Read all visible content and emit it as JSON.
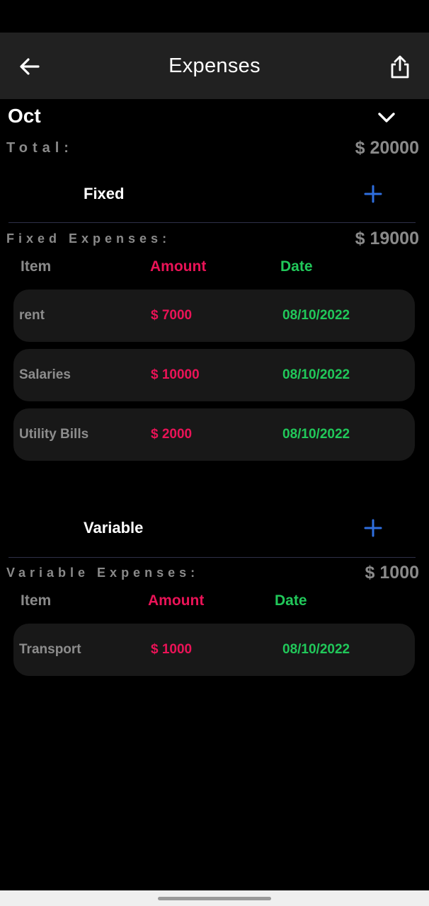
{
  "app_bar": {
    "title": "Expenses",
    "back_icon": "arrow-left-icon",
    "share_icon": "share-icon"
  },
  "month": {
    "label": "Oct",
    "toggle_icon": "chevron-down-icon"
  },
  "total": {
    "label": "Total:",
    "value": "$ 20000"
  },
  "columns": {
    "item": "Item",
    "amount": "Amount",
    "date": "Date"
  },
  "fixed": {
    "title": "Fixed",
    "add_icon": "plus-icon",
    "summary_label": "Fixed Expenses:",
    "summary_value": "$ 19000",
    "rows": [
      {
        "item": "rent",
        "amount": "$ 7000",
        "date": "08/10/2022"
      },
      {
        "item": "Salaries",
        "amount": "$ 10000",
        "date": "08/10/2022"
      },
      {
        "item": "Utility Bills",
        "amount": "$ 2000",
        "date": "08/10/2022"
      }
    ]
  },
  "variable": {
    "title": "Variable",
    "add_icon": "plus-icon",
    "summary_label": "Variable Expenses:",
    "summary_value": "$ 1000",
    "rows": [
      {
        "item": "Transport",
        "amount": "$ 1000",
        "date": "08/10/2022"
      }
    ]
  },
  "colors": {
    "background": "#000000",
    "app_bar": "#212121",
    "muted_text": "#8a8a8a",
    "amount": "#ea1357",
    "date": "#21c85a",
    "accent": "#2f6fe0",
    "row_background": "#181818"
  }
}
